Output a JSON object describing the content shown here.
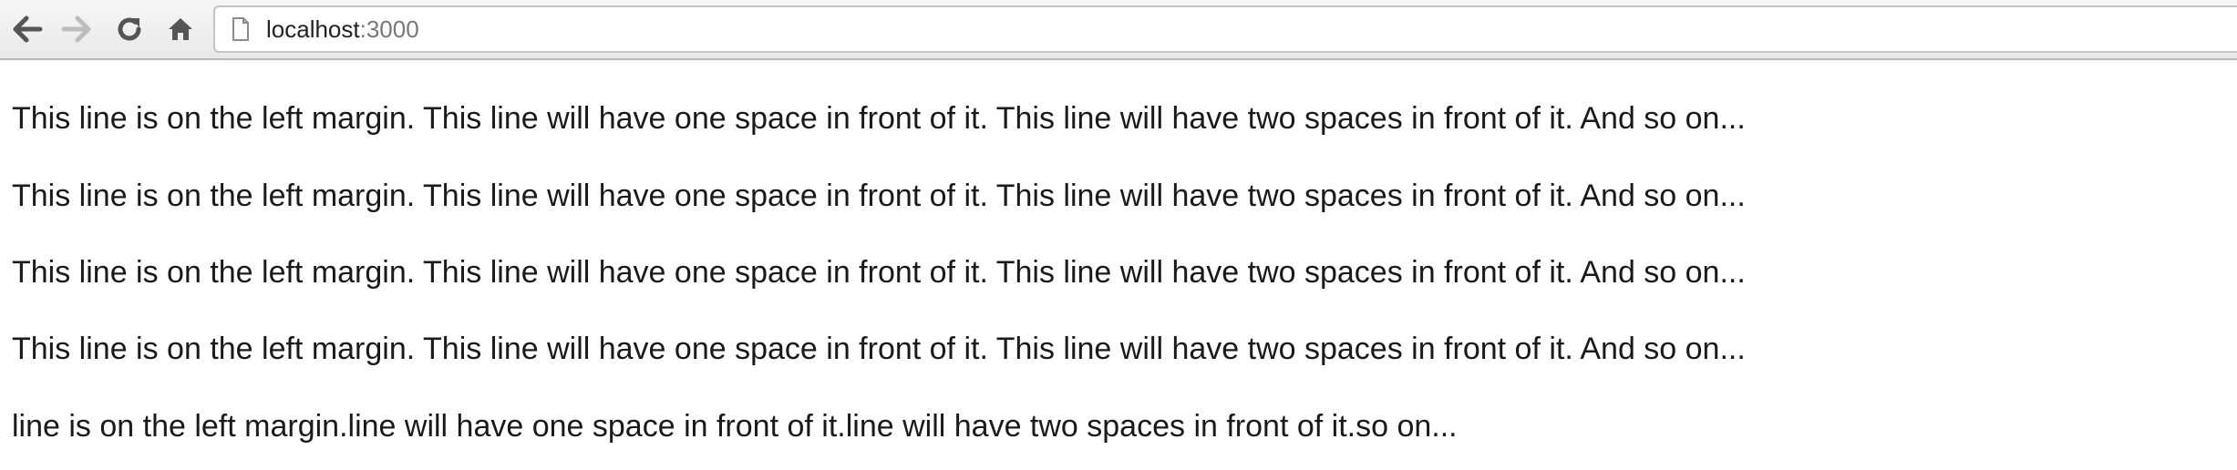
{
  "browser": {
    "url_host": "localhost",
    "url_port": ":3000",
    "icons": {
      "back": "arrow-left-icon",
      "forward": "arrow-right-icon",
      "reload": "reload-icon",
      "home": "home-icon",
      "page": "page-icon"
    },
    "colors": {
      "toolbar_bg": "#ececec",
      "icon_active": "#555555",
      "icon_disabled": "#bdbdbd"
    }
  },
  "page": {
    "lines": [
      "This line is on the left margin. This line will have one space in front of it. This line will have two spaces in front of it. And so on...",
      "This line is on the left margin. This line will have one space in front of it. This line will have two spaces in front of it. And so on...",
      "This line is on the left margin. This line will have one space in front of it. This line will have two spaces in front of it. And so on...",
      "This line is on the left margin. This line will have one space in front of it. This line will have two spaces in front of it. And so on...",
      "line is on the left margin.line will have one space in front of it.line will have two spaces in front of it.so on..."
    ]
  }
}
